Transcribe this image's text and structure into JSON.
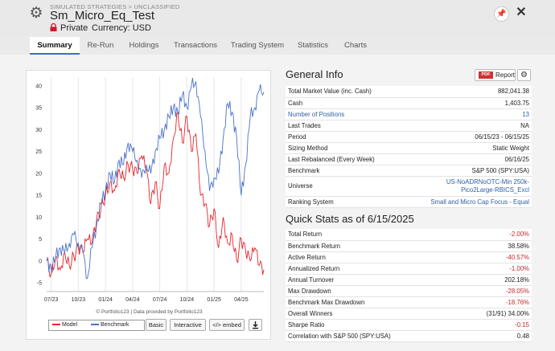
{
  "header": {
    "breadcrumb": "SIMULATED STRATEGIES > UNCLASSIFIED",
    "title": "Sm_Micro_Eq_Test",
    "privacy": "Private",
    "currency": "Currency: USD",
    "pin_icon": "pin-icon",
    "close_icon": "close-icon"
  },
  "tabs": [
    "Summary",
    "Re-Run",
    "Holdings",
    "Transactions",
    "Trading System",
    "Statistics",
    "Charts"
  ],
  "active_tab": "Summary",
  "chart": {
    "credit": "© Portfolio123 | Data provided by Portfolio123",
    "legend": [
      "Model",
      "Benchmark"
    ],
    "buttons": {
      "basic": "Basic",
      "interactive": "Interactive",
      "embed": "</> embed",
      "download_icon": "download-icon"
    }
  },
  "chart_data": {
    "type": "line",
    "x_ticks": [
      "07/23",
      "10/23",
      "01/24",
      "04/24",
      "07/24",
      "10/24",
      "01/25",
      "04/25"
    ],
    "y_ticks": [
      -5,
      0,
      5,
      10,
      15,
      20,
      25,
      30,
      35,
      40
    ],
    "ylim": [
      -7,
      42
    ],
    "x_range": [
      "06/15/23",
      "06/15/25"
    ],
    "grid": "vertical",
    "legend_position": "bottom-left",
    "series": [
      {
        "name": "Model",
        "color": "#e8242a",
        "points": [
          [
            0,
            0
          ],
          [
            0.5,
            -3
          ],
          [
            1,
            1
          ],
          [
            1.5,
            -2
          ],
          [
            2,
            2
          ],
          [
            2.5,
            -1
          ],
          [
            3,
            1
          ],
          [
            3.5,
            3
          ],
          [
            4,
            2
          ],
          [
            4.5,
            5
          ],
          [
            5,
            4
          ],
          [
            5.5,
            9
          ],
          [
            6,
            12
          ],
          [
            6.5,
            15
          ],
          [
            7,
            18
          ],
          [
            7.5,
            16
          ],
          [
            8,
            21
          ],
          [
            8.5,
            19
          ],
          [
            9,
            22
          ],
          [
            9.5,
            21
          ],
          [
            10,
            20
          ],
          [
            10.5,
            24
          ],
          [
            11,
            21
          ],
          [
            11.5,
            13
          ],
          [
            12,
            18
          ],
          [
            12.5,
            12
          ],
          [
            13,
            22
          ],
          [
            13.5,
            20
          ],
          [
            14,
            28
          ],
          [
            14.5,
            34
          ],
          [
            15,
            27
          ],
          [
            15.5,
            33
          ],
          [
            16,
            25
          ],
          [
            16.5,
            29
          ],
          [
            17,
            15
          ],
          [
            17.5,
            13
          ],
          [
            18,
            8
          ],
          [
            18.5,
            12
          ],
          [
            19,
            3
          ],
          [
            19.5,
            10
          ],
          [
            20,
            4
          ],
          [
            20.5,
            6
          ],
          [
            21,
            0
          ],
          [
            21.5,
            5
          ],
          [
            22,
            2
          ],
          [
            22.5,
            0
          ],
          [
            23,
            3
          ],
          [
            23.5,
            -1
          ],
          [
            24,
            -2
          ]
        ]
      },
      {
        "name": "Benchmark",
        "color": "#4a72c9",
        "points": [
          [
            0,
            0
          ],
          [
            0.5,
            -2
          ],
          [
            1,
            1
          ],
          [
            1.5,
            3
          ],
          [
            2,
            2
          ],
          [
            2.5,
            4
          ],
          [
            3,
            6
          ],
          [
            3.5,
            4
          ],
          [
            4,
            2
          ],
          [
            4.5,
            -4
          ],
          [
            5,
            3
          ],
          [
            5.5,
            8
          ],
          [
            6,
            13
          ],
          [
            6.5,
            16
          ],
          [
            7,
            20
          ],
          [
            7.5,
            18
          ],
          [
            8,
            23
          ],
          [
            8.5,
            22
          ],
          [
            9,
            27
          ],
          [
            9.5,
            25
          ],
          [
            10,
            23
          ],
          [
            10.5,
            19
          ],
          [
            11,
            22
          ],
          [
            11.5,
            20
          ],
          [
            12,
            25
          ],
          [
            12.5,
            28
          ],
          [
            13,
            30
          ],
          [
            13.5,
            33
          ],
          [
            14,
            35
          ],
          [
            14.5,
            34
          ],
          [
            15,
            38
          ],
          [
            15.5,
            35
          ],
          [
            16,
            40
          ],
          [
            16.5,
            41
          ],
          [
            17,
            33
          ],
          [
            17.5,
            25
          ],
          [
            18,
            16
          ],
          [
            18.5,
            19
          ],
          [
            19,
            20
          ],
          [
            19.5,
            28
          ],
          [
            20,
            36
          ],
          [
            20.5,
            34
          ],
          [
            21,
            28
          ],
          [
            21.5,
            15
          ],
          [
            22,
            22
          ],
          [
            22.5,
            33
          ],
          [
            23,
            35
          ],
          [
            23.5,
            39
          ],
          [
            24,
            38.6
          ]
        ]
      }
    ]
  },
  "general_info": {
    "title": "General Info",
    "report_label": "Report",
    "pdf_label": "PDF",
    "rows": [
      {
        "label": "Total Market Value (inc. Cash)",
        "value": "882,041.38"
      },
      {
        "label": "Cash",
        "value": "1,403.75"
      },
      {
        "label": "Number of Positions",
        "value": "13"
      },
      {
        "label": "Last Trades",
        "value": "NA"
      },
      {
        "label": "Period",
        "value": "06/15/23 - 06/15/25"
      },
      {
        "label": "Sizing Method",
        "value": "Static Weight"
      },
      {
        "label": "Last Rebalanced (Every Week)",
        "value": "06/16/25"
      },
      {
        "label": "Benchmark",
        "value": "S&P 500 (SPY:USA)"
      },
      {
        "label": "Universe",
        "value": "US-NoADRNoOTC-Min 250k-Pico2Large-RBICS_Excl"
      },
      {
        "label": "Ranking System",
        "value": "Small and Micro Cap Focus - Equal"
      }
    ]
  },
  "quick_stats": {
    "title": "Quick Stats as of 6/15/2025",
    "rows": [
      {
        "label": "Total Return",
        "value": "-2.00%"
      },
      {
        "label": "Benchmark Return",
        "value": "38.58%"
      },
      {
        "label": "Active Return",
        "value": "-40.57%"
      },
      {
        "label": "Annualized Return",
        "value": "-1.00%"
      },
      {
        "label": "Annual Turnover",
        "value": "202.18%"
      },
      {
        "label": "Max Drawdown",
        "value": "-28.05%"
      },
      {
        "label": "Benchmark Max Drawdown",
        "value": "-18.76%"
      },
      {
        "label": "Overall Winners",
        "value": "(31/91) 34.00%"
      },
      {
        "label": "Sharpe Ratio",
        "value": "-0.15"
      },
      {
        "label": "Correlation with S&P 500 (SPY:USA)",
        "value": "0.48"
      }
    ]
  }
}
